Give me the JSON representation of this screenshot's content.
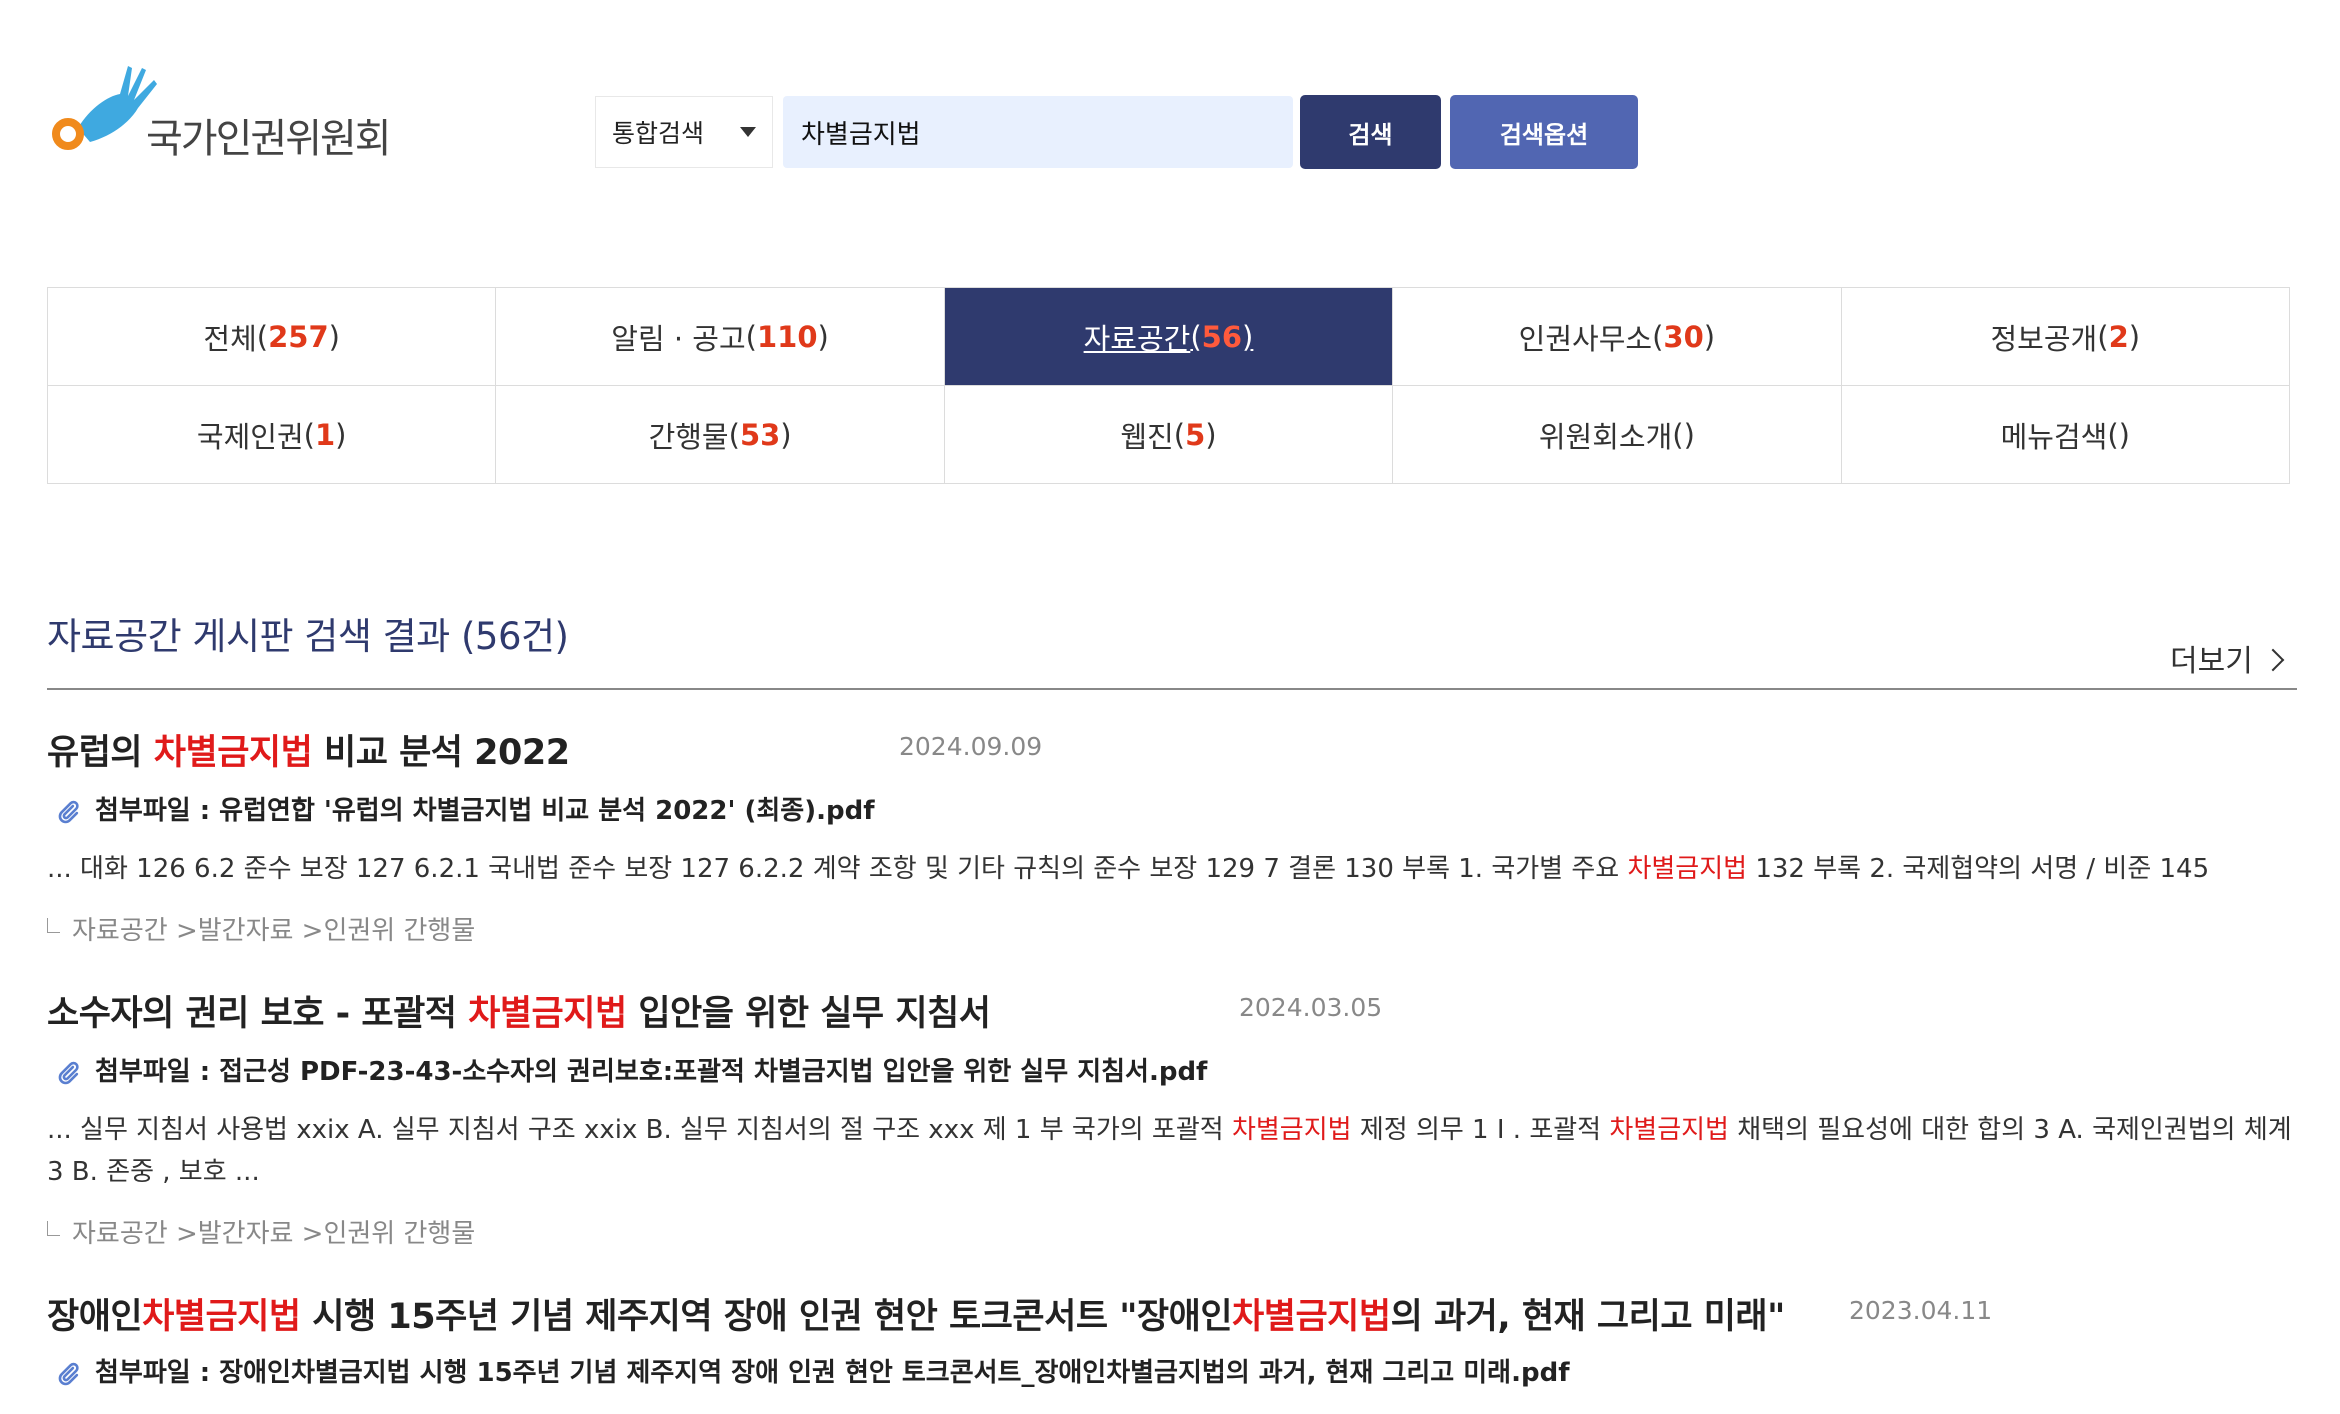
{
  "logo": {
    "text": "국가인권위원회",
    "colors": {
      "hand": "#3fa9e0",
      "circle": "#f08a1c"
    }
  },
  "search": {
    "scope": "통합검색",
    "query": "차별금지법",
    "search_label": "검색",
    "options_label": "검색옵션"
  },
  "tabs": [
    {
      "label": "전체",
      "count": "257",
      "active": false
    },
    {
      "label": "알림 · 공고",
      "count": "110",
      "active": false
    },
    {
      "label": "자료공간",
      "count": "56",
      "active": true
    },
    {
      "label": "인권사무소",
      "count": "30",
      "active": false
    },
    {
      "label": "정보공개",
      "count": "2",
      "active": false
    },
    {
      "label": "국제인권",
      "count": "1",
      "active": false
    },
    {
      "label": "간행물",
      "count": "53",
      "active": false
    },
    {
      "label": "웹진",
      "count": "5",
      "active": false
    },
    {
      "label": "위원회소개",
      "count": "",
      "active": false
    },
    {
      "label": "메뉴검색",
      "count": "",
      "active": false
    }
  ],
  "section": {
    "title": "자료공간 게시판 검색 결과 (56건)",
    "more_label": "더보기"
  },
  "results": [
    {
      "title_pre": "유럽의 ",
      "title_hl": "차별금지법",
      "title_post": " 비교 분석 2022",
      "date": "2024.09.09",
      "attachment": "첨부파일 : 유럽연합 '유럽의 차별금지법 비교 분석 2022' (최종).pdf",
      "snippet_pre": "... 대화 126 6.2 준수 보장 127 6.2.1 국내법 준수 보장 127 6.2.2 계약 조항 및 기타 규칙의 준수 보장 129 7 결론 130 부록 1. 국가별 주요 ",
      "snippet_hl": "차별금지법",
      "snippet_post": " 132 부록 2. 국제협약의 서명 / 비준 145",
      "path": "자료공간 >발간자료 >인권위 간행물"
    },
    {
      "title_pre": "소수자의 권리 보호 - 포괄적 ",
      "title_hl": "차별금지법",
      "title_post": " 입안을 위한 실무 지침서",
      "date": "2024.03.05",
      "attachment": "첨부파일 : 접근성 PDF-23-43-소수자의 권리보호:포괄적 차별금지법 입안을 위한 실무 지침서.pdf",
      "snippet_pre": "... 실무 지침서 사용법 xxix A. 실무 지침서 구조 xxix B. 실무 지침서의 절 구조 xxx 제 1 부 국가의 포괄적 ",
      "snippet_hl": "차별금지법",
      "snippet_mid": " 제정 의무 1 Ⅰ . 포괄적 ",
      "snippet_hl2": "차별금지법",
      "snippet_post": " 채택의 필요성에 대한 합의 3 A. 국제인권법의 체계 3 B. 존중 , 보호 ...",
      "path": "자료공간 >발간자료 >인권위 간행물"
    },
    {
      "title_pre": "장애인",
      "title_hl": "차별금지법",
      "title_mid": " 시행 15주년 기념 제주지역 장애 인권 현안 토크콘서트 \"장애인",
      "title_hl2": "차별금지법",
      "title_post": "의 과거, 현재 그리고 미래\"",
      "date": "2023.04.11",
      "attachment": "첨부파일 : 장애인차별금지법 시행 15주년 기념 제주지역 장애 인권 현안 토크콘서트_장애인차별금지법의 과거, 현재 그리고 미래.pdf"
    }
  ]
}
